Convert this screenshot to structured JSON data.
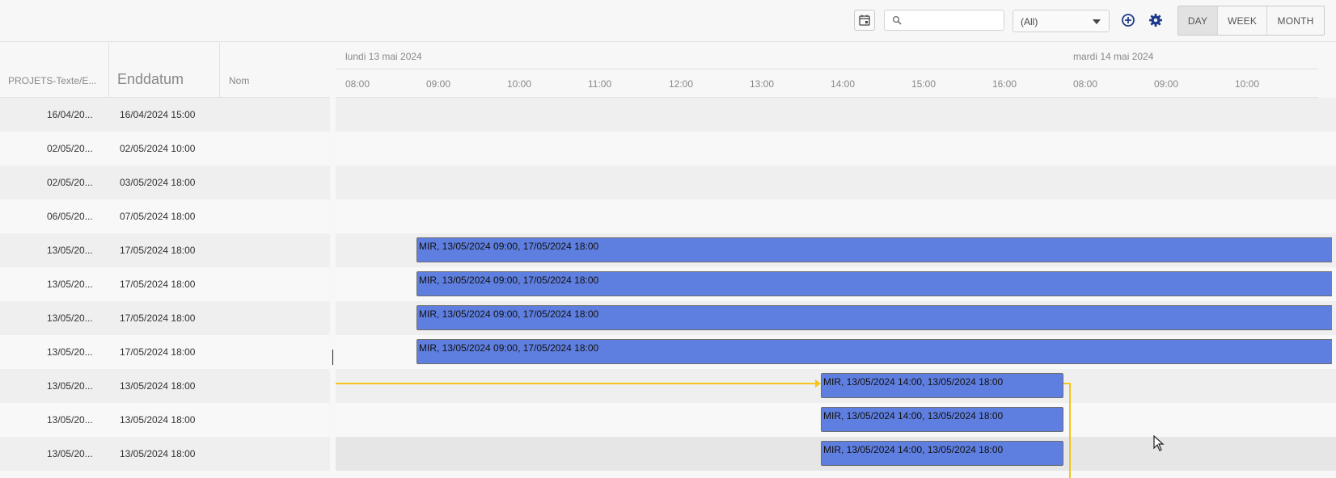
{
  "toolbar": {
    "search_value": "",
    "filter_selected": "(All)",
    "views": [
      {
        "label": "DAY",
        "active": true
      },
      {
        "label": "WEEK",
        "active": false
      },
      {
        "label": "MONTH",
        "active": false
      }
    ],
    "icons": {
      "date_picker": "calendar-icon",
      "search": "search-icon",
      "add": "add-circle-icon",
      "settings": "gear-icon"
    }
  },
  "grid": {
    "columns": [
      "PROJETS-Texte/E...",
      "Enddatum",
      "Nom"
    ]
  },
  "timeline": {
    "days": [
      "lundi 13 mai 2024",
      "mardi 14 mai 2024"
    ],
    "hours": [
      "08:00",
      "09:00",
      "10:00",
      "11:00",
      "12:00",
      "13:00",
      "14:00",
      "15:00",
      "16:00",
      "08:00",
      "09:00",
      "10:00"
    ]
  },
  "rows": [
    {
      "start": "16/04/20...",
      "end": "16/04/2024 15:00",
      "name": "",
      "bar": ""
    },
    {
      "start": "02/05/20...",
      "end": "02/05/2024 10:00",
      "name": "",
      "bar": ""
    },
    {
      "start": "02/05/20...",
      "end": "03/05/2024 18:00",
      "name": "",
      "bar": ""
    },
    {
      "start": "06/05/20...",
      "end": "07/05/2024 18:00",
      "name": "",
      "bar": ""
    },
    {
      "start": "13/05/20...",
      "end": "17/05/2024 18:00",
      "name": "",
      "bar": "MIR, 13/05/2024 09:00, 17/05/2024 18:00"
    },
    {
      "start": "13/05/20...",
      "end": "17/05/2024 18:00",
      "name": "",
      "bar": "MIR, 13/05/2024 09:00, 17/05/2024 18:00"
    },
    {
      "start": "13/05/20...",
      "end": "17/05/2024 18:00",
      "name": "",
      "bar": "MIR, 13/05/2024 09:00, 17/05/2024 18:00"
    },
    {
      "start": "13/05/20...",
      "end": "17/05/2024 18:00",
      "name": "",
      "bar": "MIR, 13/05/2024 09:00, 17/05/2024 18:00"
    },
    {
      "start": "13/05/20...",
      "end": "13/05/2024 18:00",
      "name": "",
      "bar": "MIR, 13/05/2024 14:00, 13/05/2024 18:00"
    },
    {
      "start": "13/05/20...",
      "end": "13/05/2024 18:00",
      "name": "",
      "bar": "MIR, 13/05/2024 14:00, 13/05/2024 18:00"
    },
    {
      "start": "13/05/20...",
      "end": "13/05/2024 18:00",
      "name": "",
      "bar": "MIR, 13/05/2024 14:00, 13/05/2024 18:00"
    }
  ],
  "colors": {
    "task_bar": "#5f7fe0",
    "dependency_line": "#f5c518",
    "icon_accent": "#1f3a8a"
  }
}
